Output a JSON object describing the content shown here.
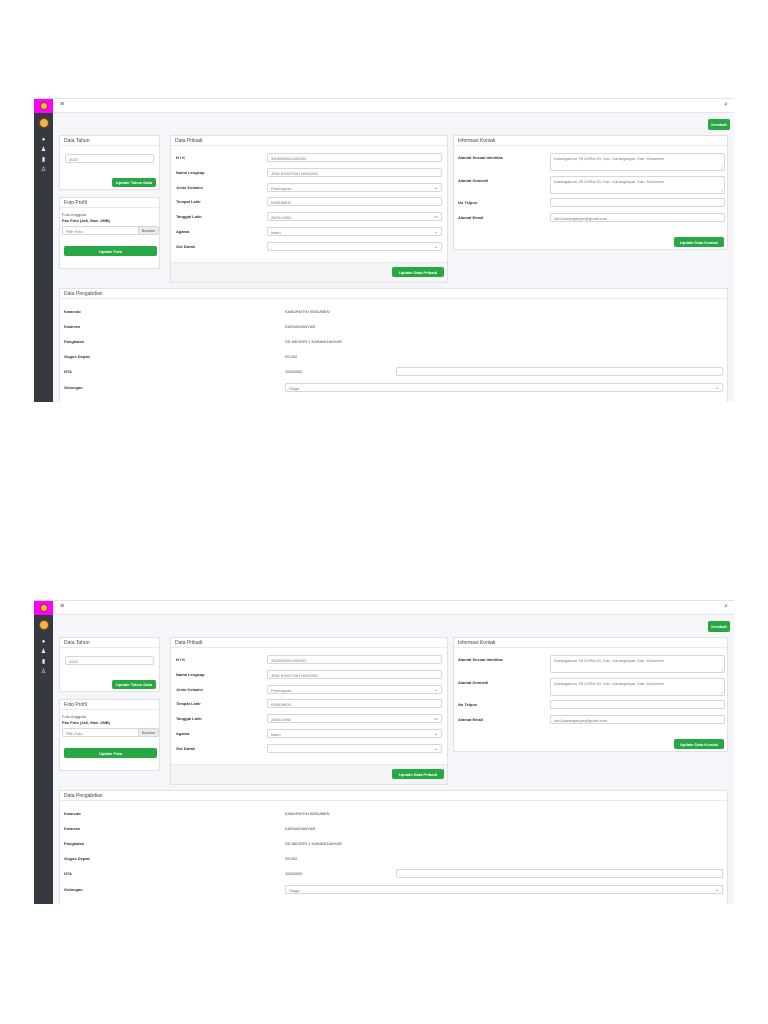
{
  "sidebar": {
    "nav_icons": [
      "dashboard-icon",
      "users-icon",
      "file-icon",
      "user-icon"
    ]
  },
  "topbar": {
    "menu_icon": "≡",
    "search_icon": "⌕"
  },
  "actions": {
    "back": "Kembali"
  },
  "data_tahun": {
    "title": "Data Tahun",
    "year_value": "2022",
    "update_button": "Update Tahun Data"
  },
  "foto_profil": {
    "title": "Foto Profil",
    "image_alt": "Foto Anggota",
    "hint": "Pas Foto (4x6, Max. 2MB)",
    "file_placeholder": "Pilih Foto",
    "browse": "Browse",
    "update_button": "Update Foto"
  },
  "data_pribadi": {
    "title": "Data Pribadi",
    "labels": {
      "nik": "N I K",
      "nama": "Nama Lengkap",
      "jk": "Jenis Kelamin",
      "tempat": "Tempat Lahir",
      "tanggal": "Tanggal Lahir",
      "agama": "Agama",
      "goldar": "Gol Darah"
    },
    "values": {
      "nik": "3305206911490002",
      "nama": "JENI KHATIYAH NINGSIH",
      "jk": "Perempuan",
      "tempat": "KEBUMEN",
      "tanggal": "28/01/1984",
      "agama": "Islam",
      "goldar": "-"
    },
    "update_button": "Update Data Pribadi"
  },
  "informasi_kontak": {
    "title": "Informasi Kontak",
    "labels": {
      "alamat_identitas": "Alamat Sesuai Identitas",
      "alamat_domisili": "Alamat Domisili",
      "telpon": "No Telpon",
      "email": "Alamat Email"
    },
    "values": {
      "alamat_identitas": "Karanganom, Rt 02/Rw 01, Kec. Karanganyar, Kab. Kebumen",
      "alamat_domisili": "Karanganom, Rt 02/Rw 01, Kec. Karanganyar, Kab. Kebumen",
      "telpon": "-",
      "email": "sdn1karanganyar@gmail.com"
    },
    "update_button": "Update Data Kontak"
  },
  "data_pengabdian": {
    "title": "Data Pengabdian",
    "labels": {
      "kwarcab": "Kwarcab",
      "kwarran": "Kwarran",
      "pangkalan": "Pangkalan",
      "gudep": "Gugus Depan",
      "nta": "NTA",
      "golongan": "Golongan"
    },
    "values": {
      "kwarcab": "KABUPATEN KEBUMEN",
      "kwarran": "KARANGANYAR",
      "pangkalan": "SD NEGERI 1 KARANGANYAR",
      "gudep": "09.002",
      "nta": "11030002",
      "nta_extra": "-",
      "golongan": "Siaga"
    }
  }
}
